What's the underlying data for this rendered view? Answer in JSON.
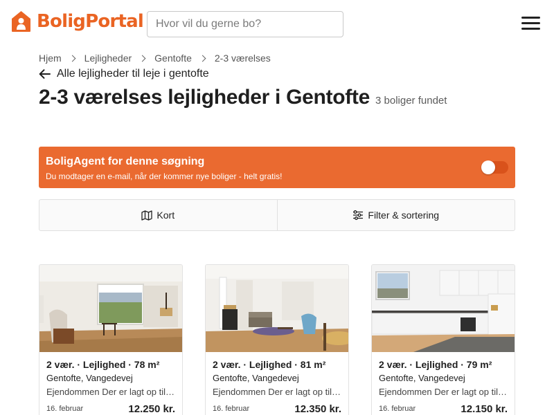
{
  "brand": {
    "name": "BoligPortal",
    "accent": "#ea6423",
    "banner_color": "#ea6a30"
  },
  "header": {
    "search_placeholder": "Hvor vil du gerne bo?",
    "menu_icon": "hamburger-menu-icon"
  },
  "breadcrumb": [
    "Hjem",
    "Lejligheder",
    "Gentofte",
    "2-3 værelses"
  ],
  "back_link": "Alle lejligheder til leje i gentofte",
  "page": {
    "title": "2-3 værelses lejligheder i Gentofte",
    "count": "3 boliger fundet"
  },
  "agent": {
    "title": "BoligAgent for denne søgning",
    "subtitle": "Du modtager en e-mail, når der kommer nye boliger - helt gratis!",
    "enabled": false
  },
  "actions": {
    "map_label": "Kort",
    "filter_label": "Filter & sortering"
  },
  "listings": [
    {
      "headline": "2 vær. · Lejlighed · 78 m²",
      "location": "Gentofte, Vangedevej",
      "description": "Ejendommen Der er lagt op til en",
      "date": "16. februar",
      "price": "12.250 kr."
    },
    {
      "headline": "2 vær. · Lejlighed · 81 m²",
      "location": "Gentofte, Vangedevej",
      "description": "Ejendommen Der er lagt op til en",
      "date": "16. februar",
      "price": "12.350 kr."
    },
    {
      "headline": "2 vær. · Lejlighed · 79 m²",
      "location": "Gentofte, Vangedevej",
      "description": "Ejendommen Der er lagt op til en",
      "date": "16. februar",
      "price": "12.150 kr."
    }
  ]
}
